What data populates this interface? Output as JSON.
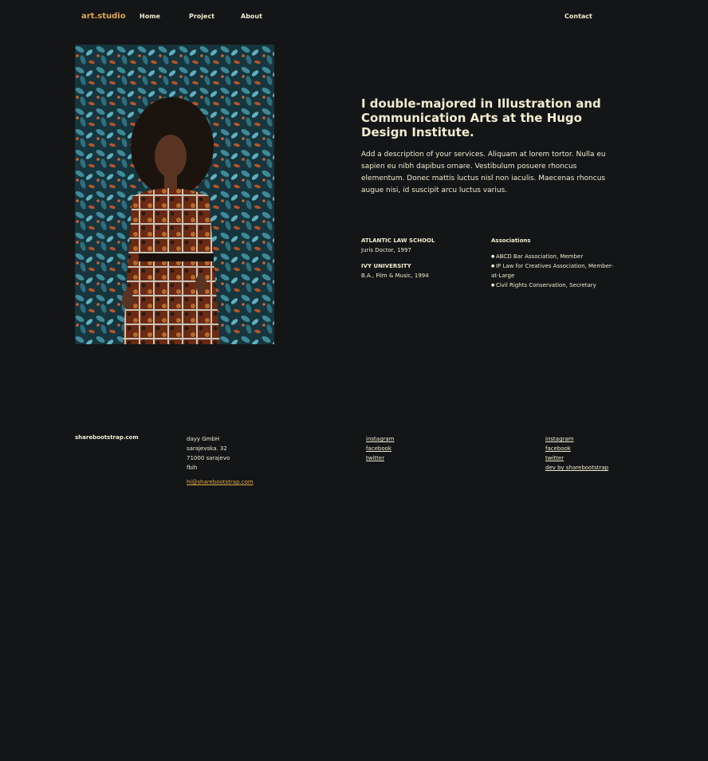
{
  "nav": {
    "brand": "art.studio",
    "items": [
      "Home",
      "Project",
      "About"
    ],
    "contact": "Contact"
  },
  "about": {
    "headline": "I double-majored in Illustration and Communication Arts at the Hugo Design Institute.",
    "description": "Add a description of your services. Aliquam at lorem tortor. Nulla eu sapien eu nibh dapibus ornare. Vestibulum posuere rhoncus elementum. Donec mattis luctus nisl non iaculis. Maecenas rhoncus augue nisi, id suscipit arcu luctus varius.",
    "education": [
      {
        "school": "ATLANTIC LAW SCHOOL",
        "degree": "Juris Doctor, 1997"
      },
      {
        "school": "IVY UNIVERSITY",
        "degree": "B.A., Film & Music, 1994"
      }
    ],
    "associations_title": "Associations",
    "associations": [
      "ABCD Bar Association, Member",
      "IP Law for Creatives Association, Member-at-Large",
      "Civil Rights Conservation, Secretary"
    ]
  },
  "footer": {
    "site": "sharebootstrap.com",
    "address": [
      "dayy GmbH",
      "sarajevska. 32",
      "71000 sarajevo",
      "fbih"
    ],
    "email": "hi@sharebootstrap.com",
    "social_a": [
      "instagram",
      "facebook",
      "twitter"
    ],
    "social_b": [
      "instagram",
      "facebook",
      "twitter",
      "dev by sharebootstrap"
    ]
  },
  "colors": {
    "background": "#131517",
    "text": "#f3ecd0",
    "accent": "#e0a94a"
  }
}
